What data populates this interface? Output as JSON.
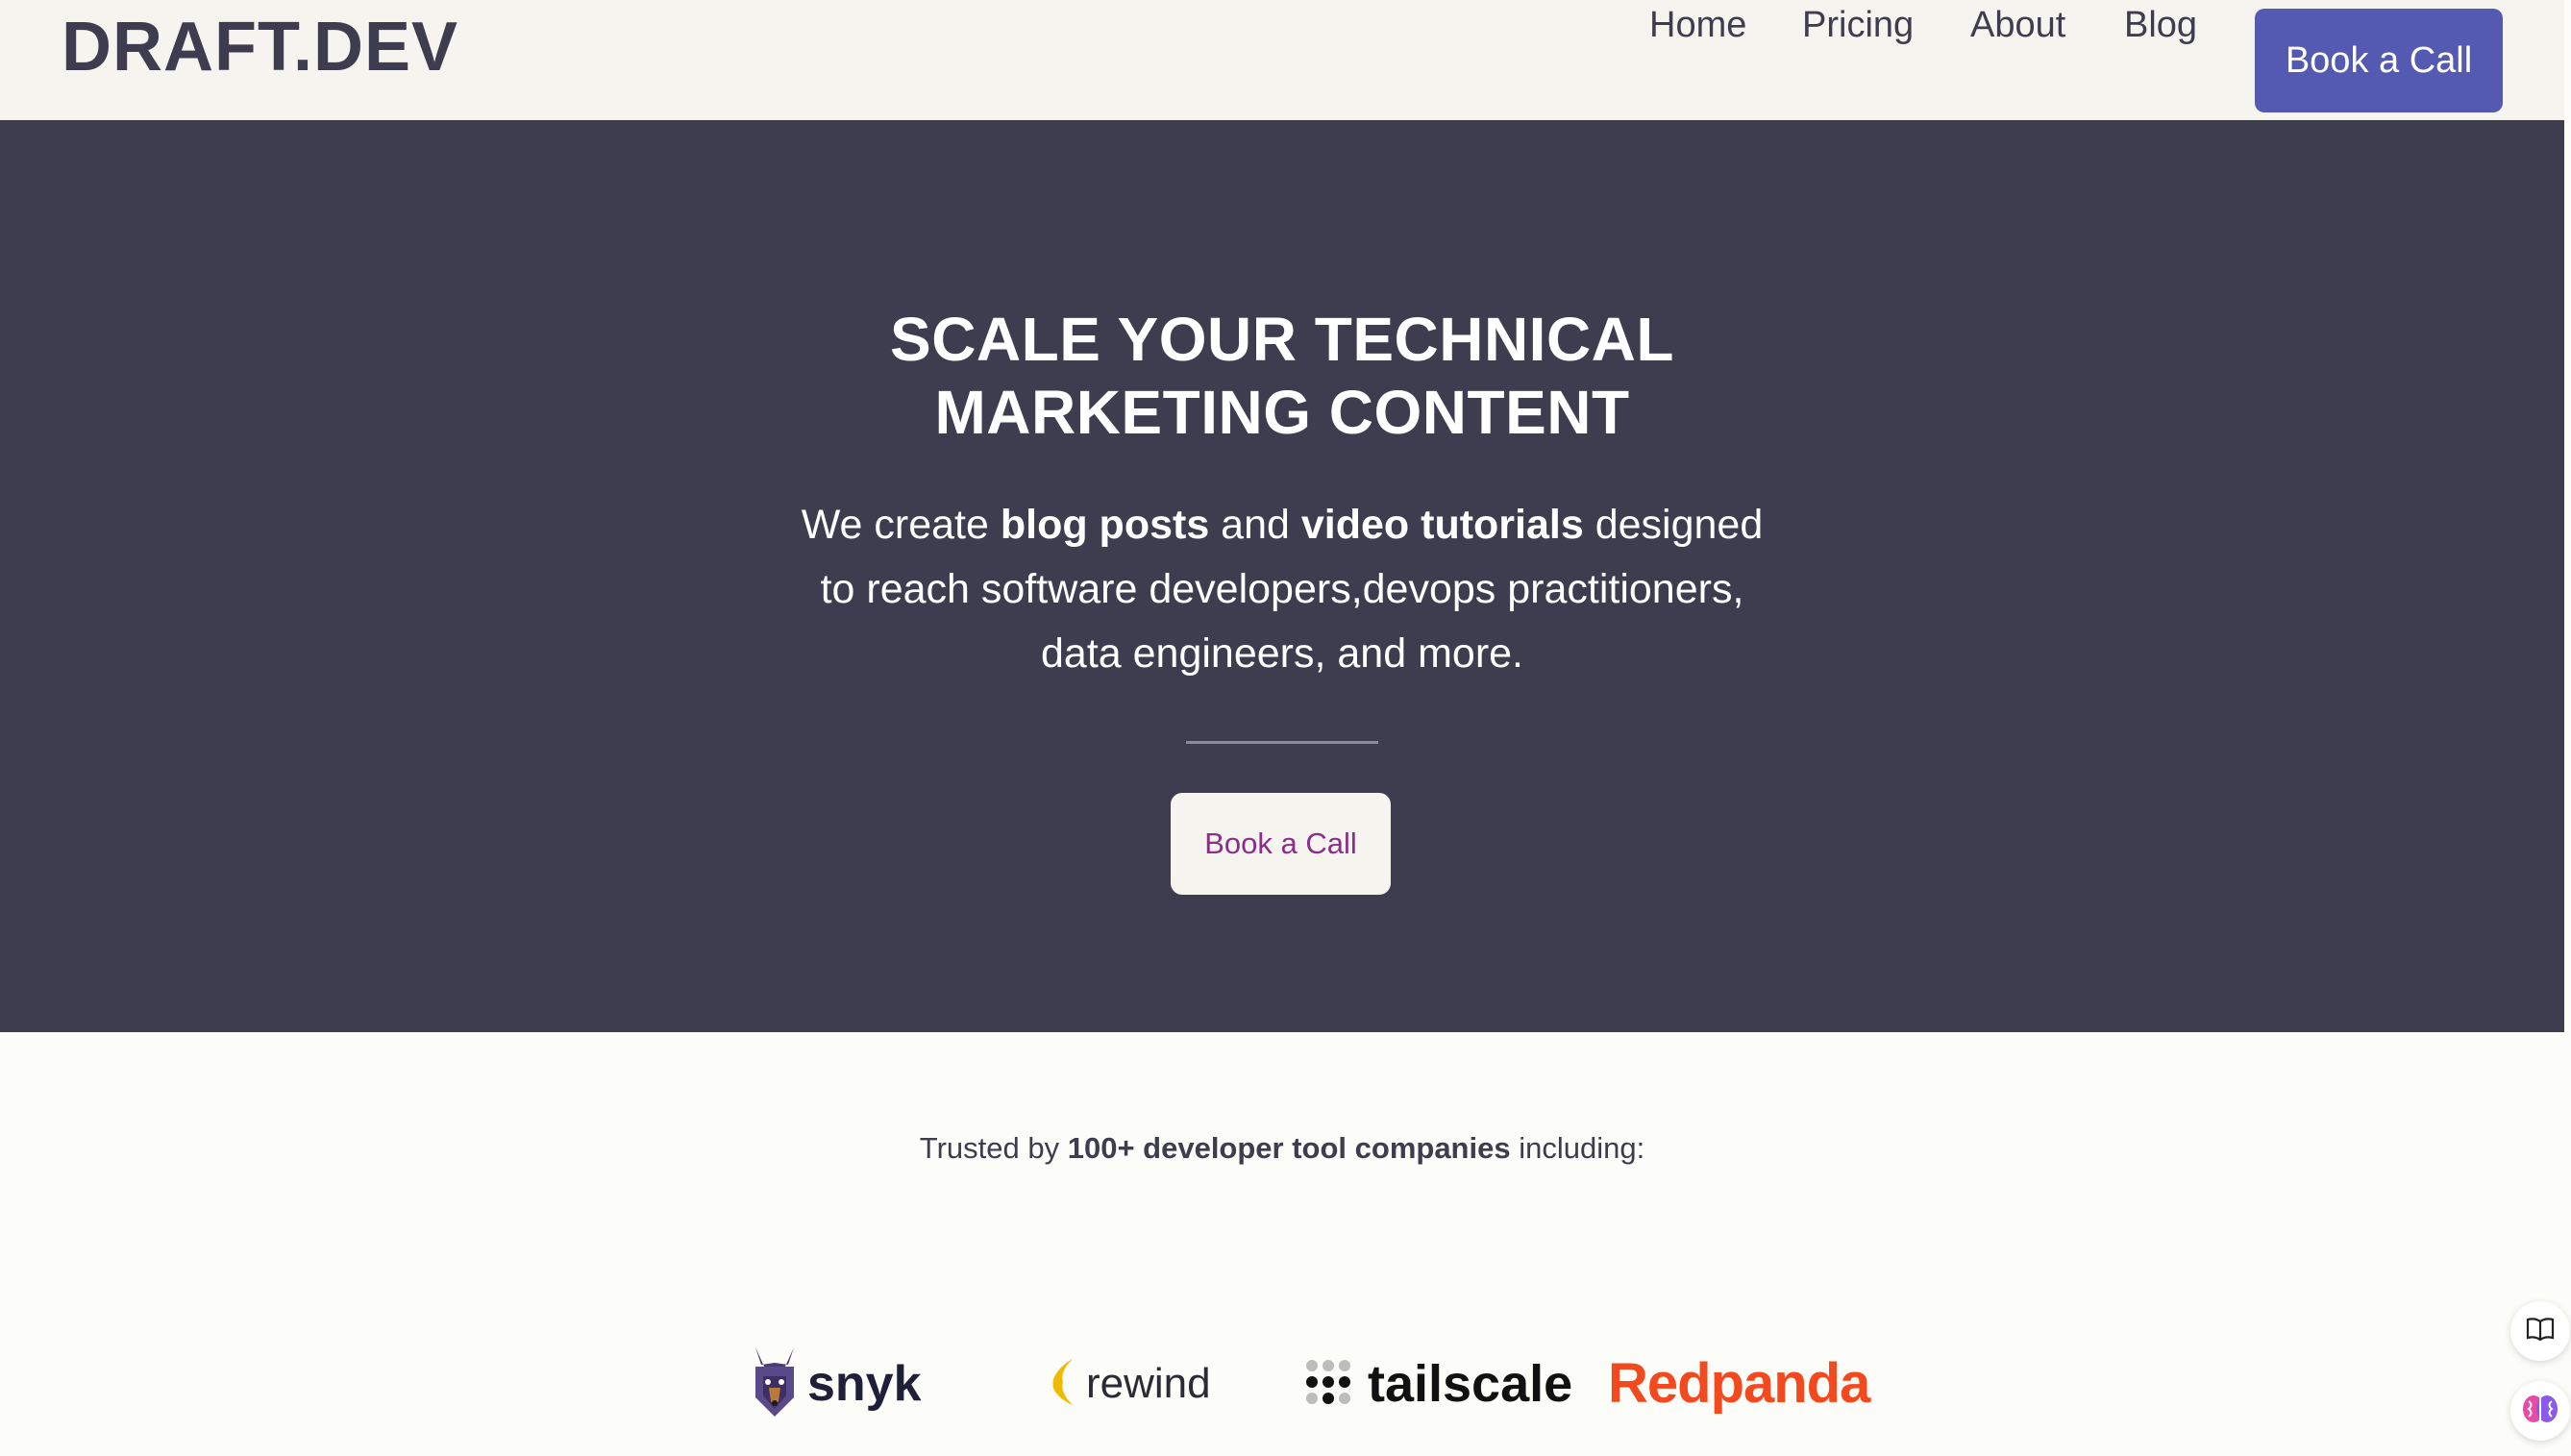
{
  "brand": {
    "name": "DRAFT.DEV"
  },
  "nav": {
    "links": [
      "Home",
      "Pricing",
      "About",
      "Blog"
    ],
    "cta_label": "Book a Call"
  },
  "hero": {
    "title_line1": "SCALE YOUR TECHNICAL",
    "title_line2": "MARKETING CONTENT",
    "subtitle_part1": "We create ",
    "subtitle_bold1": "blog posts",
    "subtitle_part2": " and ",
    "subtitle_bold2": "video tutorials",
    "subtitle_part3": " designed to reach software developers,devops practitioners, data engineers, and more.",
    "cta_label": "Book a Call"
  },
  "trusted": {
    "prefix": "Trusted by ",
    "bold": "100+ developer tool companies",
    "suffix": " including:"
  },
  "logos": [
    {
      "name": "snyk",
      "icon": "doberman-mascot-icon",
      "color": "#1f1f3a"
    },
    {
      "name": "rewind",
      "icon": "yellow-chevron-icon",
      "color": "#2b2b35"
    },
    {
      "name": "tailscale",
      "icon": "dot-grid-icon",
      "color": "#111111"
    },
    {
      "name": "Redpanda",
      "icon": "none",
      "color": "#f2491e"
    }
  ],
  "side_widgets": [
    {
      "icon": "open-book-icon"
    },
    {
      "icon": "brain-icon"
    }
  ],
  "colors": {
    "nav_bg": "#f5f4ef",
    "hero_bg": "#3d3d4f",
    "accent": "#5459b2",
    "hero_cta_text": "#8a2e8a",
    "page_bg": "#fcfcf8"
  }
}
